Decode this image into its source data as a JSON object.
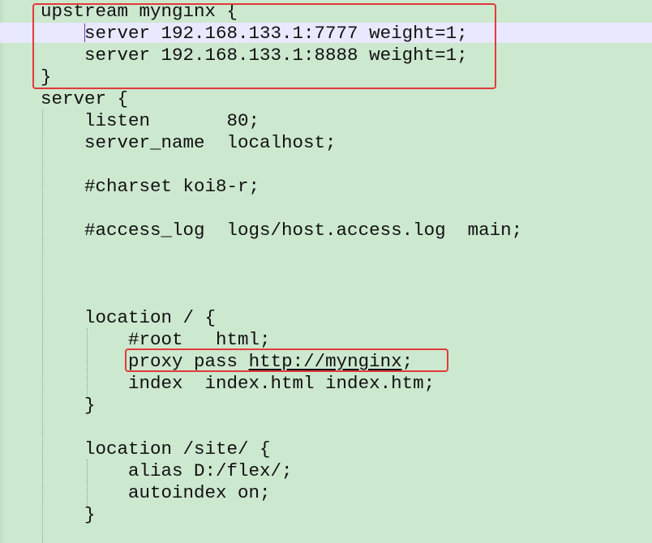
{
  "editor": {
    "lines": [
      "upstream mynginx {",
      "    server 192.168.133.1:7777 weight=1;",
      "    server 192.168.133.1:8888 weight=1;",
      "}",
      "server {",
      "    listen       80;",
      "    server_name  localhost;",
      "",
      "    #charset koi8-r;",
      "",
      "    #access_log  logs/host.access.log  main;",
      "",
      "",
      "",
      "    location / {",
      "        #root   html;",
      "",
      "        index  index.html index.htm;",
      "    }",
      "",
      "    location /site/ {",
      "        alias D:/flex/;",
      "        autoindex on;",
      "    }"
    ],
    "proxy_line": {
      "indent": "        ",
      "prefix": "proxy pass ",
      "url": "http://mynginx",
      "suffix": ";"
    },
    "colors": {
      "background": "#cce8cf",
      "current_line": "#e8e8ff",
      "highlight_border": "#e23a3a",
      "text": "#111111"
    }
  }
}
